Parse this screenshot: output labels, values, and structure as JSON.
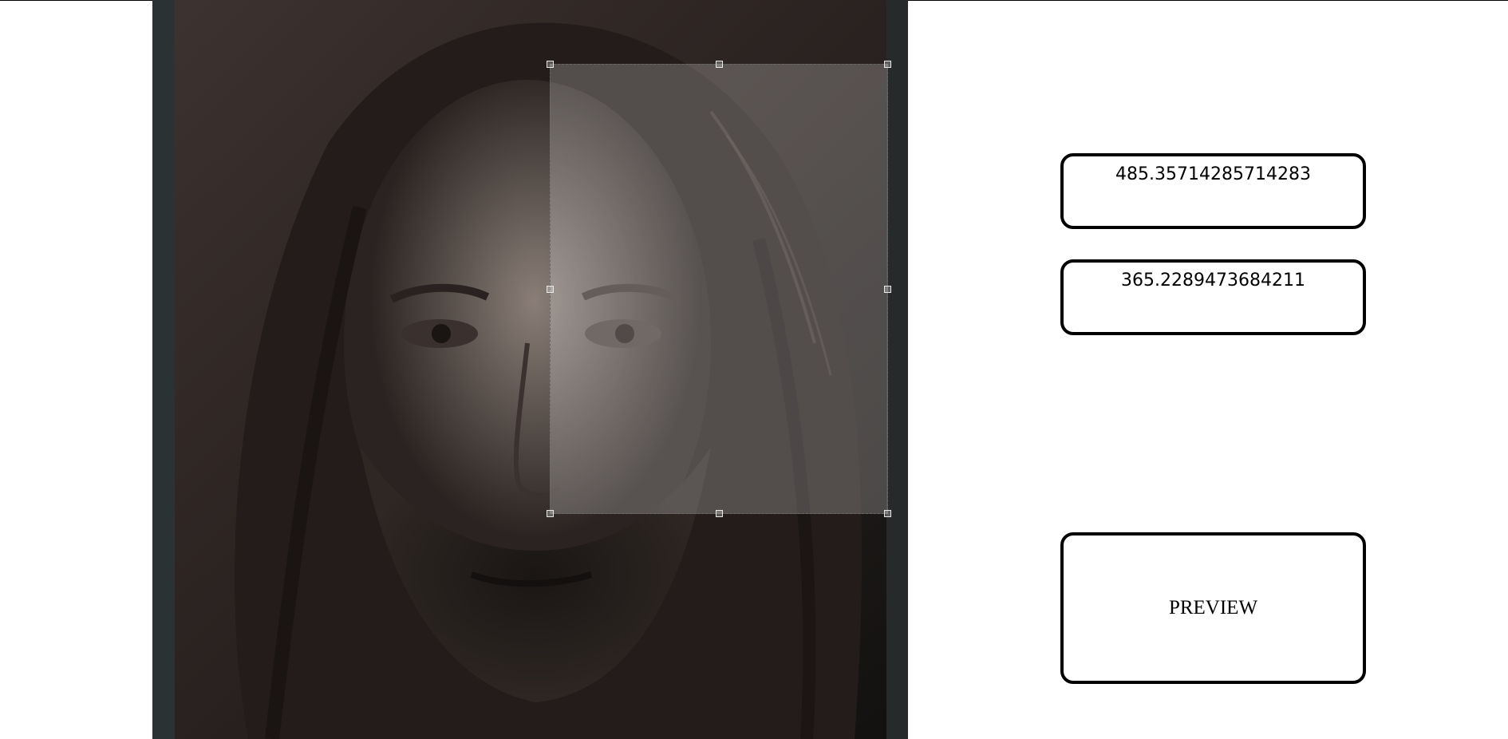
{
  "crop": {
    "width_value": "485.35714285714283",
    "height_value": "365.2289473684211"
  },
  "preview_button": {
    "label": "PREVIEW"
  },
  "image": {
    "icon": "portrait-photo"
  }
}
